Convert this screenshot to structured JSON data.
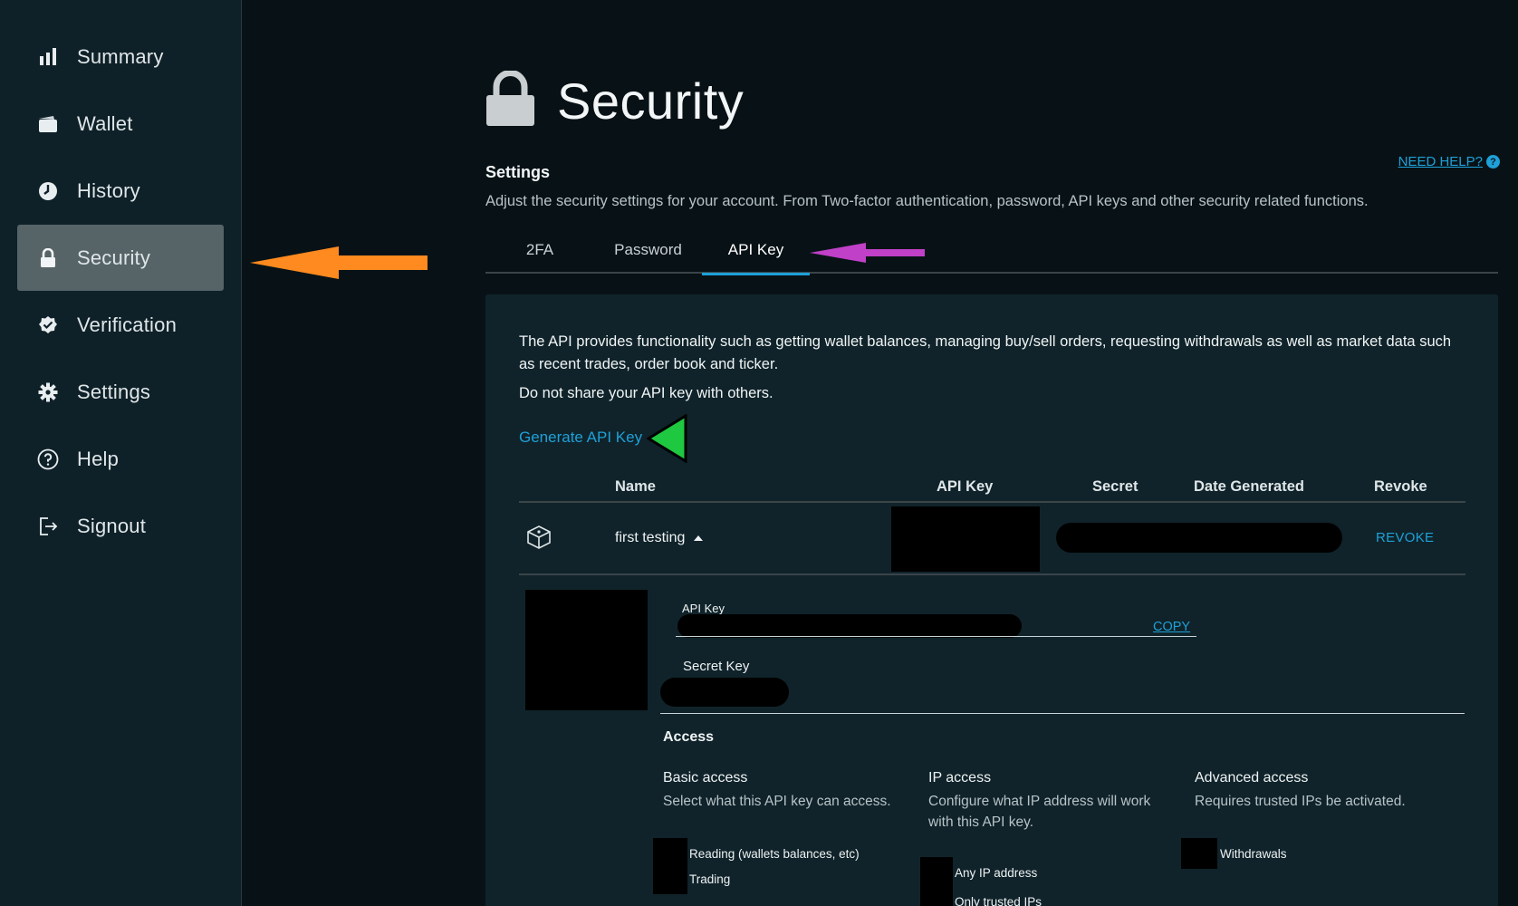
{
  "sidebar": {
    "items": [
      {
        "label": "Summary",
        "icon": "bar-chart-icon"
      },
      {
        "label": "Wallet",
        "icon": "wallet-icon"
      },
      {
        "label": "History",
        "icon": "clock-icon"
      },
      {
        "label": "Security",
        "icon": "lock-icon",
        "active": true
      },
      {
        "label": "Verification",
        "icon": "check-badge-icon"
      },
      {
        "label": "Settings",
        "icon": "gear-icon"
      },
      {
        "label": "Help",
        "icon": "question-icon"
      },
      {
        "label": "Signout",
        "icon": "signout-icon"
      }
    ]
  },
  "page": {
    "title": "Security",
    "settings_title": "Settings",
    "settings_desc": "Adjust the security settings for your account. From Two-factor authentication, password, API keys and other security related functions.",
    "need_help": "NEED HELP?",
    "help_symbol": "?"
  },
  "tabs": [
    {
      "label": "2FA"
    },
    {
      "label": "Password"
    },
    {
      "label": "API Key",
      "active": true
    }
  ],
  "api": {
    "description": "The API provides functionality such as getting wallet balances, managing buy/sell orders, requesting withdrawals as well as market data such as recent trades, order book and ticker.",
    "warning": "Do not share your API key with others.",
    "generate_link": "Generate API Key",
    "table": {
      "headers": {
        "name": "Name",
        "api_key": "API Key",
        "secret": "Secret",
        "date_generated": "Date Generated",
        "revoke": "Revoke"
      },
      "rows": [
        {
          "name": "first testing",
          "revoke_label": "REVOKE"
        }
      ]
    },
    "detail": {
      "api_key_label": "API Key",
      "copy_label": "COPY",
      "secret_key_label": "Secret Key",
      "access_title": "Access",
      "columns": [
        {
          "title": "Basic access",
          "desc": "Select what this API key can access.",
          "options": [
            "Reading (wallets balances, etc)",
            "Trading"
          ]
        },
        {
          "title": "IP access",
          "desc": "Configure what IP address will work with this API key.",
          "options": [
            "Any IP address",
            "Only trusted IPs"
          ]
        },
        {
          "title": "Advanced access",
          "desc": "Requires trusted IPs be activated.",
          "options": [
            "Withdrawals"
          ]
        }
      ]
    }
  },
  "colors": {
    "accent": "#1ea0d8",
    "annotation_orange": "#ff8a1f",
    "annotation_purple": "#c040c8",
    "annotation_green": "#1ec840"
  }
}
